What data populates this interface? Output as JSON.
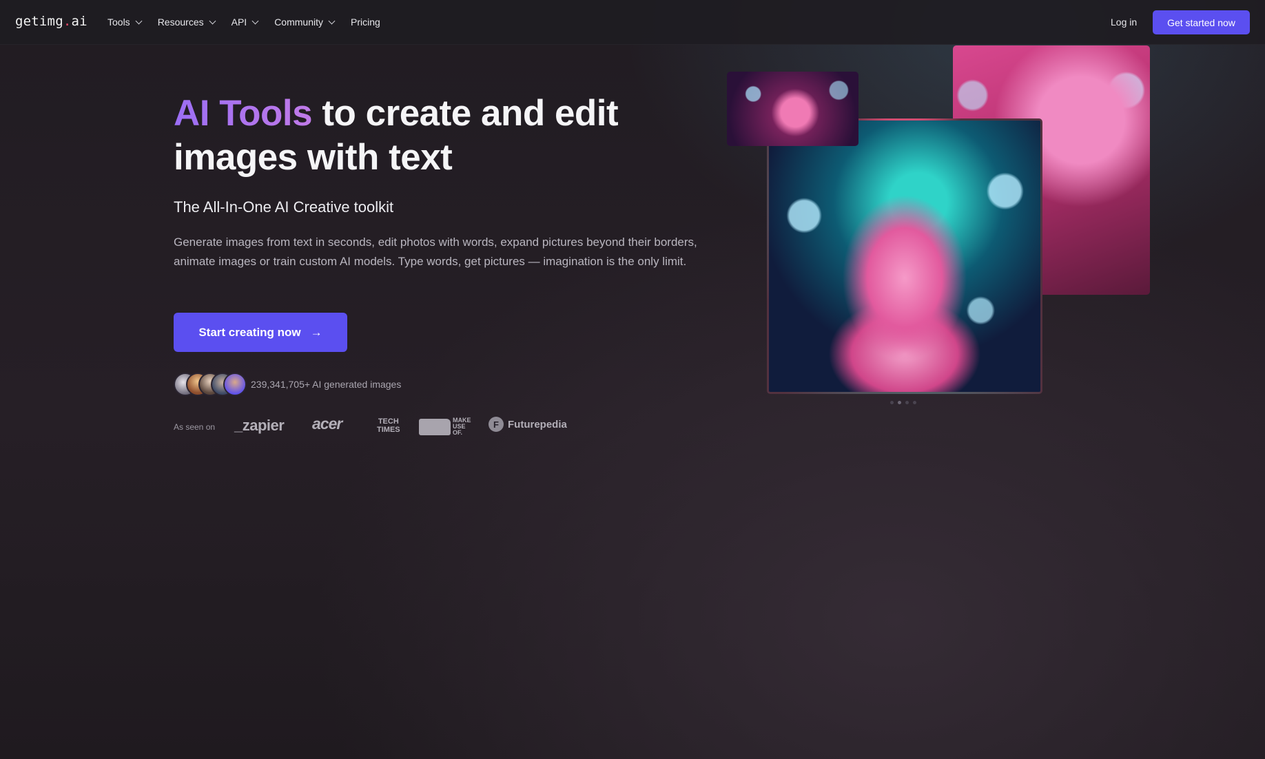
{
  "nav": {
    "logo_main": "getimg",
    "logo_dot": ".",
    "logo_tld": "ai",
    "items": [
      {
        "label": "Tools",
        "dropdown": true
      },
      {
        "label": "Resources",
        "dropdown": true
      },
      {
        "label": "API",
        "dropdown": true
      },
      {
        "label": "Community",
        "dropdown": true
      },
      {
        "label": "Pricing",
        "dropdown": false
      }
    ],
    "login": "Log in",
    "cta": "Get started now"
  },
  "hero": {
    "title_accent": "AI Tools",
    "title_rest": " to create and edit images with text",
    "subtitle": "The All-In-One AI Creative toolkit",
    "description": "Generate images from text in seconds, edit photos with words, expand pictures beyond their borders, animate images or train custom AI models. Type words, get pictures — imagination is the only limit.",
    "button": "Start creating now",
    "button_icon": "arrow-right-icon",
    "generated_count": "239,341,705+ AI generated images"
  },
  "as_seen_on": {
    "label": "As seen on",
    "brands": {
      "zapier": "_zapier",
      "acer": "acer",
      "techtimes_line1": "TECH",
      "techtimes_line2": "TIMES",
      "muo": "MAKE USE OF.",
      "futurepedia": "Futurepedia",
      "futurepedia_icon": "F"
    }
  },
  "gallery": {
    "images": [
      "pink-cat-small",
      "pink-cat-main",
      "pink-cat-right"
    ],
    "carousel_dots": 4,
    "active_dot": 1
  },
  "colors": {
    "accent": "#5b4ff0",
    "title_gradient_start": "#9b6ef5",
    "logo_dot": "#ef4a6a"
  }
}
